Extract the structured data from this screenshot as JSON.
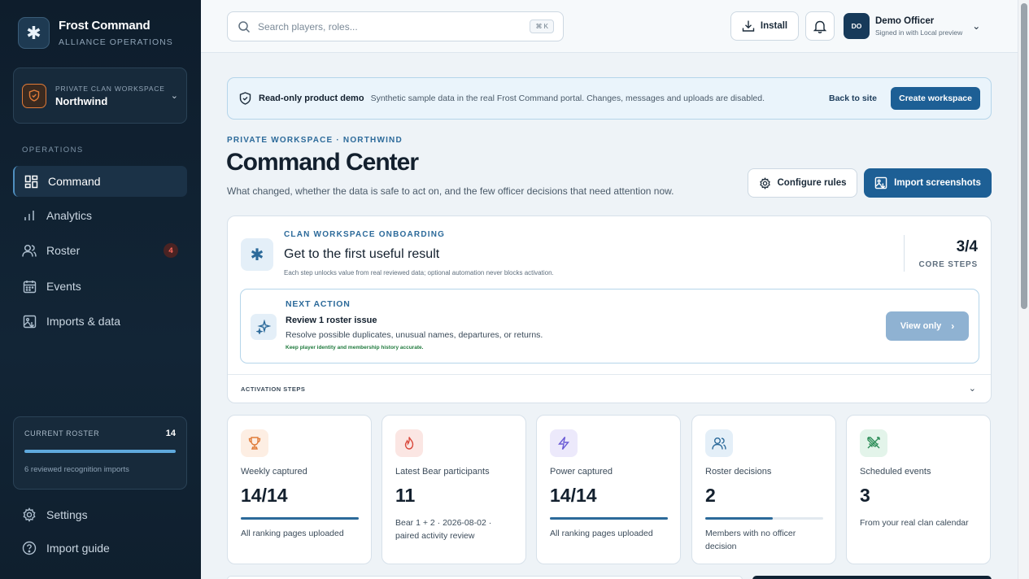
{
  "brand": {
    "name": "Frost Command",
    "subtitle": "ALLIANCE OPERATIONS"
  },
  "workspace": {
    "label": "PRIVATE CLAN WORKSPACE",
    "name": "Northwind"
  },
  "nav": {
    "section": "OPERATIONS",
    "items": [
      {
        "label": "Command",
        "icon": "dashboard-icon",
        "active": true
      },
      {
        "label": "Analytics",
        "icon": "bar-chart-icon"
      },
      {
        "label": "Roster",
        "icon": "users-icon",
        "badge": "4"
      },
      {
        "label": "Events",
        "icon": "calendar-icon"
      },
      {
        "label": "Imports & data",
        "icon": "image-import-icon"
      }
    ]
  },
  "roster_card": {
    "label": "CURRENT ROSTER",
    "value": "14",
    "progress": 1.0,
    "note": "6 reviewed recognition imports"
  },
  "footer_nav": [
    {
      "label": "Settings",
      "icon": "gear-icon"
    },
    {
      "label": "Import guide",
      "icon": "help-icon"
    }
  ],
  "topbar": {
    "search_placeholder": "Search players, roles...",
    "search_shortcut": "⌘ K",
    "install_label": "Install",
    "user": {
      "initials": "DO",
      "name": "Demo Officer",
      "status": "Signed in with Local preview"
    }
  },
  "banner": {
    "title": "Read-only product demo",
    "description": "Synthetic sample data in the real Frost Command portal. Changes, messages and uploads are disabled.",
    "back_link": "Back to site",
    "create_button": "Create workspace"
  },
  "header": {
    "eyebrow": "PRIVATE WORKSPACE · NORTHWIND",
    "title": "Command Center",
    "subtitle": "What changed, whether the data is safe to act on, and the few officer decisions that need attention now.",
    "configure_button": "Configure rules",
    "import_button": "Import screenshots"
  },
  "onboarding": {
    "eyebrow": "CLAN WORKSPACE ONBOARDING",
    "title": "Get to the first useful result",
    "note": "Each step unlocks value from real reviewed data; optional automation never blocks activation.",
    "steps_value": "3/4",
    "steps_label": "CORE STEPS",
    "next_action": {
      "eyebrow": "NEXT ACTION",
      "title": "Review 1 roster issue",
      "description": "Resolve possible duplicates, unusual names, departures, or returns.",
      "note": "Keep player identity and membership history accurate.",
      "button": "View only"
    },
    "footer_label": "ACTIVATION STEPS"
  },
  "stats": [
    {
      "label": "Weekly captured",
      "value": "14/14",
      "note": "All ranking pages uploaded",
      "progress": 1.0,
      "icon": "trophy-icon",
      "color": "#e07b39",
      "bg": "#fdeee3"
    },
    {
      "label": "Latest Bear participants",
      "value": "11",
      "note": "Bear 1 + 2 · 2026-08-02 · paired activity review",
      "icon": "flame-icon",
      "color": "#d9483b",
      "bg": "#fbe6e3"
    },
    {
      "label": "Power captured",
      "value": "14/14",
      "note": "All ranking pages uploaded",
      "progress": 1.0,
      "icon": "lightning-icon",
      "color": "#6b5bd6",
      "bg": "#ece9fb"
    },
    {
      "label": "Roster decisions",
      "value": "2",
      "note": "Members with no officer decision",
      "progress": 0.57,
      "icon": "users-icon",
      "color": "#2c6a9a",
      "bg": "#e4eff8"
    },
    {
      "label": "Scheduled events",
      "value": "3",
      "note": "From your real clan calendar",
      "icon": "swords-icon",
      "color": "#2f8f5a",
      "bg": "#e3f4ea"
    }
  ]
}
